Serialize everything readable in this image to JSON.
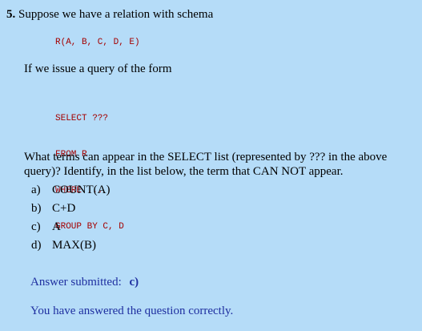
{
  "question": {
    "number": "5.",
    "intro": "Suppose we have a relation with schema",
    "schema": "R(A, B, C, D, E)",
    "query_intro": "If we issue a query of the form",
    "query_lines": [
      "SELECT ???",
      "FROM R",
      "WHERE ...",
      "GROUP BY C, D"
    ],
    "prompt_line1": "What terms can appear in the SELECT list (represented by ??? in the above",
    "prompt_line2": "query)? Identify, in the list below, the term that CAN NOT appear.",
    "choices": [
      {
        "label": "a)",
        "text": "COUNT(A)"
      },
      {
        "label": "b)",
        "text": "C+D"
      },
      {
        "label": "c)",
        "text": "A"
      },
      {
        "label": "d)",
        "text": "MAX(B)"
      }
    ]
  },
  "answer": {
    "label": "Answer submitted:",
    "value": "c)",
    "feedback": "You have answered the question correctly."
  },
  "colors": {
    "background": "#b5dcf8",
    "code": "#a40000",
    "answer_text": "#1f2fa0"
  }
}
